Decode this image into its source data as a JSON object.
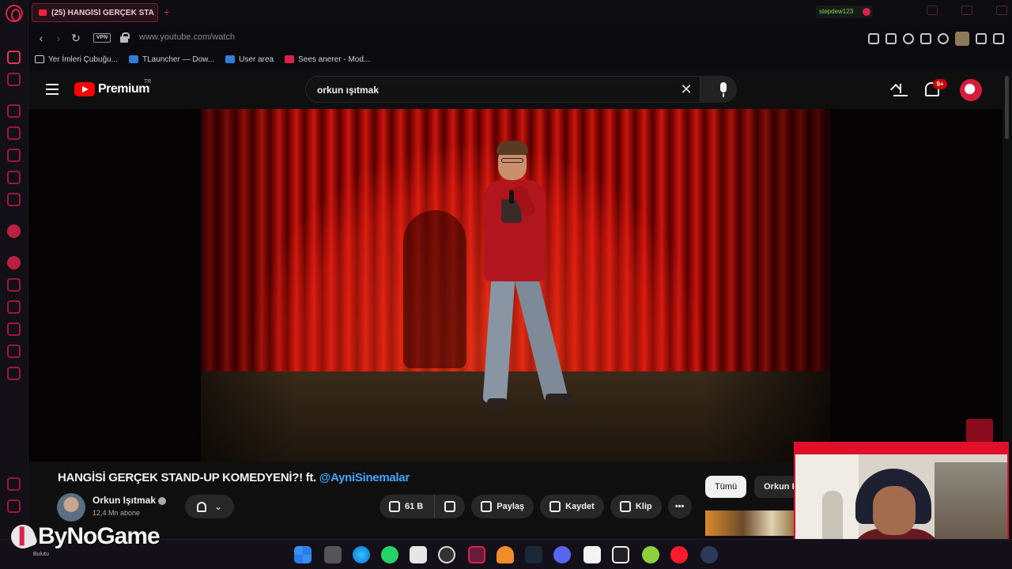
{
  "browser": {
    "tab_title": "(25) HANGİSİ GERÇEK STA",
    "url": "www.youtube.com/watch",
    "vpn_label": "VPN",
    "gx_meter_text": "stepdew123"
  },
  "bookmarks": [
    {
      "label": "Yer İmleri Çubuğu...",
      "icon": "folder-icon",
      "color": "#d4d4d4"
    },
    {
      "label": "TLauncher — Dow...",
      "icon": "tlauncher-icon",
      "color": "#2f7fd6"
    },
    {
      "label": "User area",
      "icon": "tlauncher-icon",
      "color": "#2f7fd6"
    },
    {
      "label": "Sees anerer - Mod...",
      "icon": "video-bookmark-icon",
      "color": "#d8234b"
    }
  ],
  "youtube": {
    "brand": "Premium",
    "country": "TR",
    "search_query": "orkun ışıtmak",
    "notification_count": "9+",
    "video_title": "HANGİSİ GERÇEK STAND-UP KOMEDYENİ?! ft.",
    "video_title_mention": "@AyniSinemalar",
    "channel_name": "Orkun Işıtmak",
    "subscribers": "12,4 Mn abone",
    "like_count": "61 B",
    "share_label": "Paylaş",
    "save_label": "Kaydet",
    "clip_label": "Klip",
    "more_label": "•••",
    "chips": [
      "Tümü",
      "Orkun Işı"
    ]
  },
  "watermark": {
    "brand": "ByNoGame",
    "sub": "Bulutu"
  },
  "colors": {
    "accent": "#d8234b",
    "youtube_red": "#ff0000",
    "link_blue": "#3ea6ff"
  }
}
